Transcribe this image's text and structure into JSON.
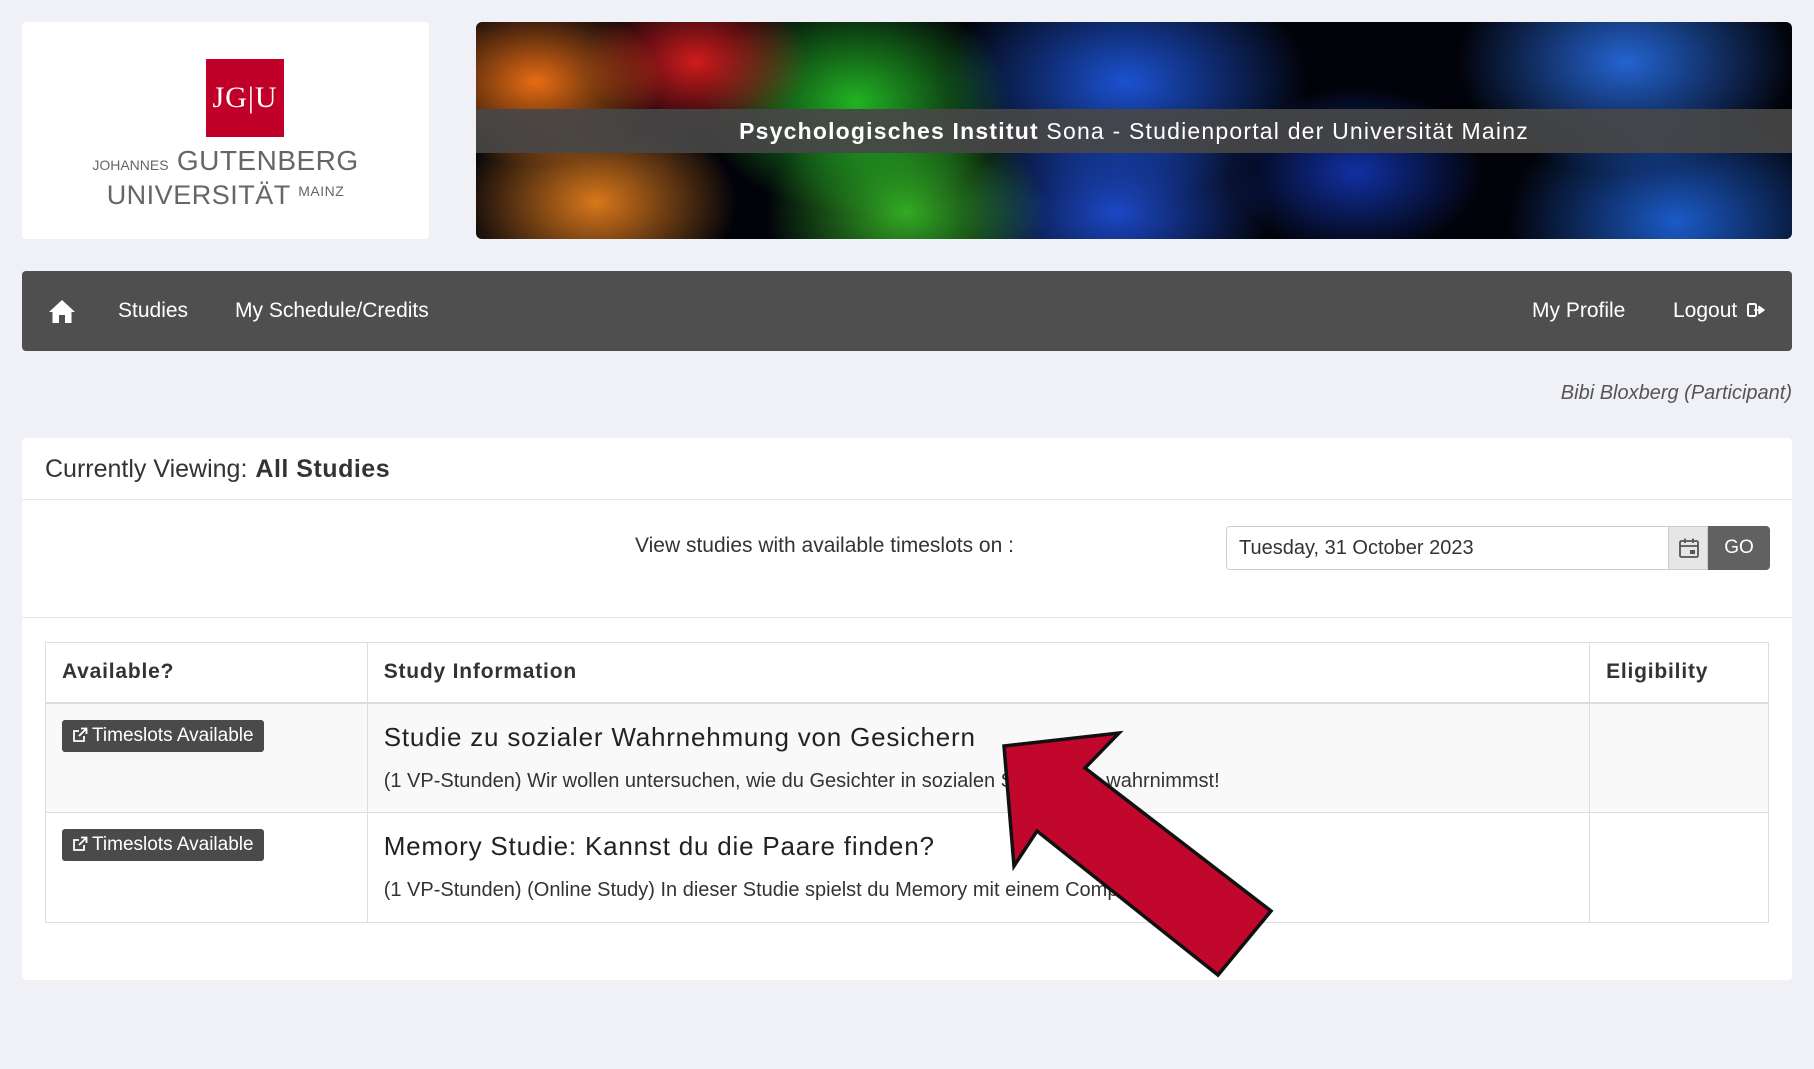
{
  "logo": {
    "monogram": "JG|U",
    "line1_prefix": "JOHANNES",
    "line1_main": "GUTENBERG",
    "line2_main": "UNIVERSITÄT",
    "line2_suffix": "MAINZ"
  },
  "banner": {
    "title_bold": "Psychologisches Institut",
    "title_rest": "Sona - Studienportal der Universität Mainz"
  },
  "nav": {
    "studies": "Studies",
    "schedule": "My Schedule/Credits",
    "profile": "My Profile",
    "logout": "Logout"
  },
  "user": {
    "name": "Bibi Bloxberg (Participant)"
  },
  "panel": {
    "viewing_label": "Currently Viewing:",
    "viewing_value": "All Studies",
    "date_label": "View studies with available timeslots on :",
    "date_value": "Tuesday, 31 October 2023",
    "go_label": "GO"
  },
  "table": {
    "headers": [
      "Available?",
      "Study Information",
      "Eligibility"
    ],
    "rows": [
      {
        "badge": "Timeslots Available",
        "title": "Studie zu sozialer Wahrnehmung von Gesichern",
        "desc": "(1 VP-Stunden) Wir wollen untersuchen, wie du Gesichter in sozialen Situationen wahrnimmst!",
        "eligibility": ""
      },
      {
        "badge": "Timeslots Available",
        "title": "Memory Studie: Kannst du die Paare finden?",
        "desc": "(1 VP-Stunden) (Online Study) In dieser Studie spielst du Memory mit einem Computer.",
        "eligibility": ""
      }
    ]
  },
  "colors": {
    "navbar": "#4f4f4f",
    "badge": "#4a4a4a",
    "brand_red": "#c1002a",
    "arrow": "#c1072b"
  }
}
